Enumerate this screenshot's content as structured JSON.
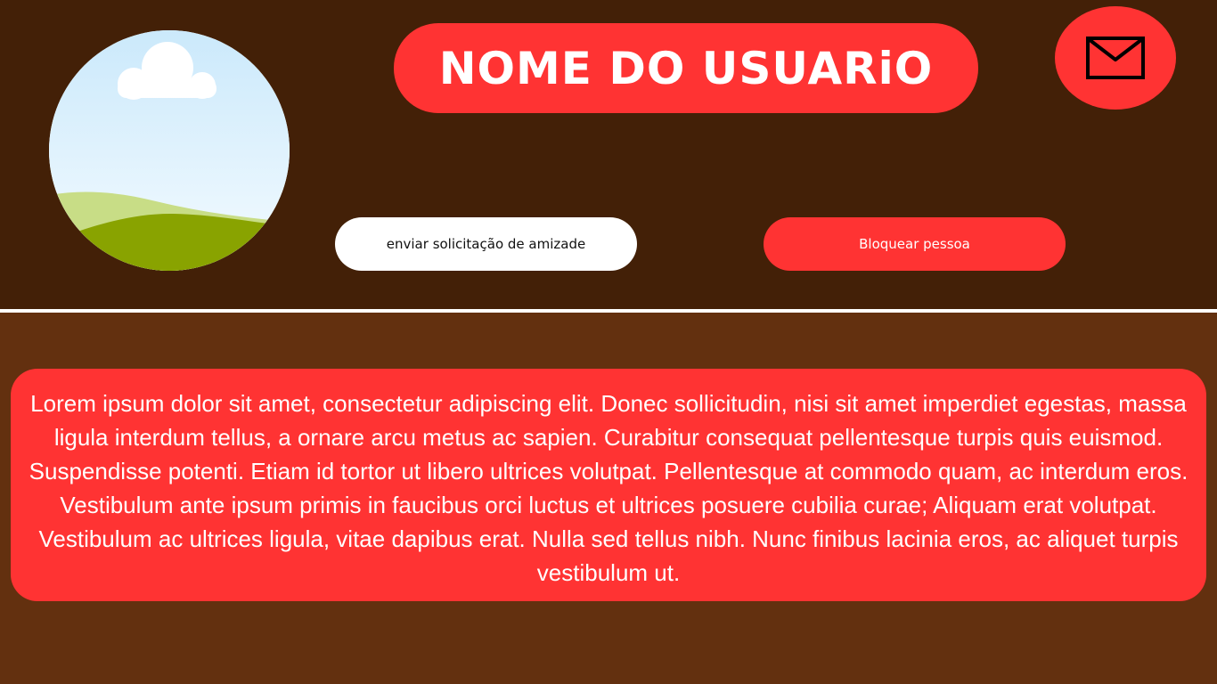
{
  "profile": {
    "user_name": "NOME DO USUARiO",
    "avatar_description_icon": "landscape-icon",
    "mail_icon": "envelope-icon"
  },
  "actions": {
    "friend_request_label": "enviar solicitação de amizade",
    "block_label": "Bloquear pessoa"
  },
  "bio": {
    "text": "Lorem ipsum dolor sit amet, consectetur adipiscing elit. Donec sollicitudin, nisi sit amet imperdiet egestas, massa ligula interdum tellus, a ornare arcu metus ac sapien. Curabitur consequat pellentesque turpis quis euismod. Suspendisse potenti. Etiam id tortor ut libero ultrices volutpat. Pellentesque at commodo quam, ac interdum eros. Vestibulum ante ipsum primis in faucibus orci luctus et ultrices posuere cubilia curae; Aliquam erat volutpat. Vestibulum ac ultrices ligula, vitae dapibus erat. Nulla sed tellus nibh. Nunc finibus lacinia eros, ac aliquet turpis vestibulum ut."
  },
  "colors": {
    "header_bg": "#432007",
    "body_bg": "#63300f",
    "accent_red": "#ff3333",
    "white": "#ffffff"
  }
}
